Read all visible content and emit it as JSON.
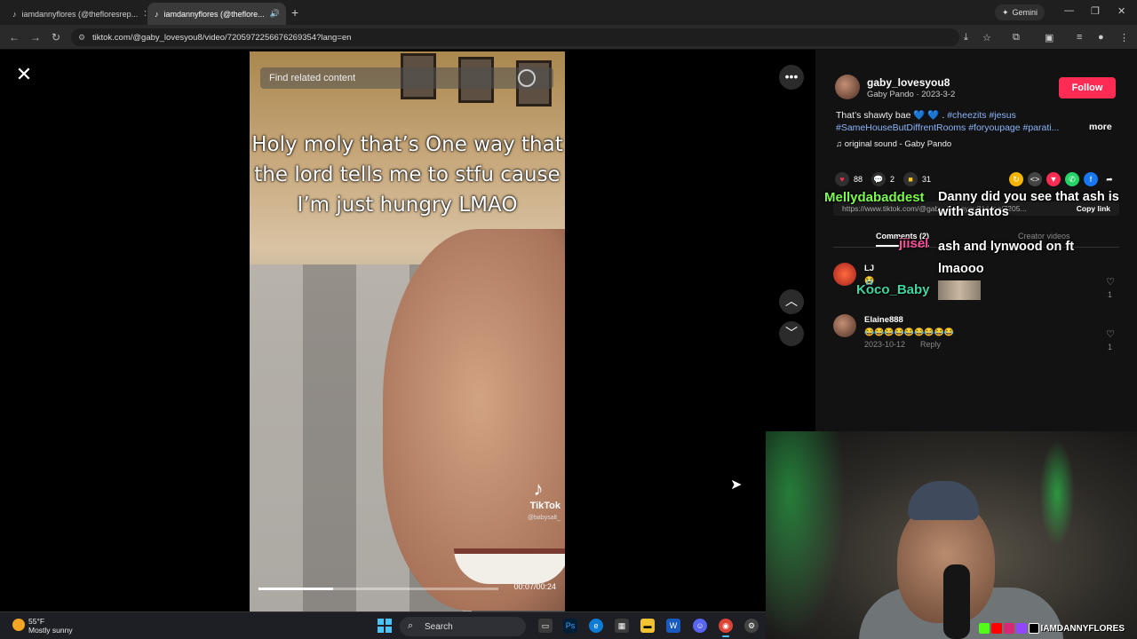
{
  "browser": {
    "tabs": [
      {
        "label": "iamdannyflores (@thefloresrep..."
      },
      {
        "label": "iamdannyflores (@theflore..."
      }
    ],
    "gemini_label": "Gemini",
    "url": "tiktok.com/@gaby_lovesyou8/video/7205972256676269354?lang=en"
  },
  "video": {
    "find_placeholder": "Find related content",
    "caption": "Holy moly that’s One way that the lord tells me to stfu cause I’m just hungry LMAO",
    "watermark_brand": "TikTok",
    "watermark_handle": "@babysalt_",
    "time": "00:07/00:24",
    "progress_fraction": 0.31
  },
  "post": {
    "username": "gaby_lovesyou8",
    "subline": "Gaby Pando · 2023-3-2",
    "follow_label": "Follow",
    "desc_text": "That’s shawty bae 💙 💙 .",
    "hashtags_line1": "#cheezits #jesus",
    "hashtags_line2": "#SameHouseButDiffrentRooms #foryoupage #parati...",
    "more_label": "more",
    "sound": "original sound - Gaby Pando",
    "likes": "88",
    "comments": "2",
    "saves": "31",
    "share_url": "https://www.tiktok.com/@gaby_lovesyou8/video/7205...",
    "copy_link_label": "Copy link",
    "tab_comments": "Comments (2)",
    "tab_creator": "Creator videos"
  },
  "comments": [
    {
      "name": "LJ",
      "text": "😭",
      "likes": "1"
    },
    {
      "name": "Elaine888",
      "text": "😂😂😂😂😂😂😂😂😂",
      "date": "2023-10-12",
      "reply": "Reply",
      "likes": "1"
    }
  ],
  "chat_overlay": [
    {
      "user": "Mellydabaddest",
      "msg": "Danny did you see that ash is with santos",
      "user_color": "#7CFC4F"
    },
    {
      "user": "jiisel",
      "msg": "ash and lynwood on ft lmaooo",
      "user_color": "#ff4f9d"
    },
    {
      "user": "Koco_Baby",
      "msg": "",
      "user_color": "#3fd6a4"
    }
  ],
  "stream": {
    "social_handle": "IAMDANNYFLORES"
  },
  "taskbar": {
    "temp": "55°F",
    "condition": "Mostly sunny",
    "search_label": "Search"
  },
  "colors": {
    "follow": "#fe2c55",
    "hashtag": "#8ab4f8",
    "accent": "#4cc2ff"
  }
}
